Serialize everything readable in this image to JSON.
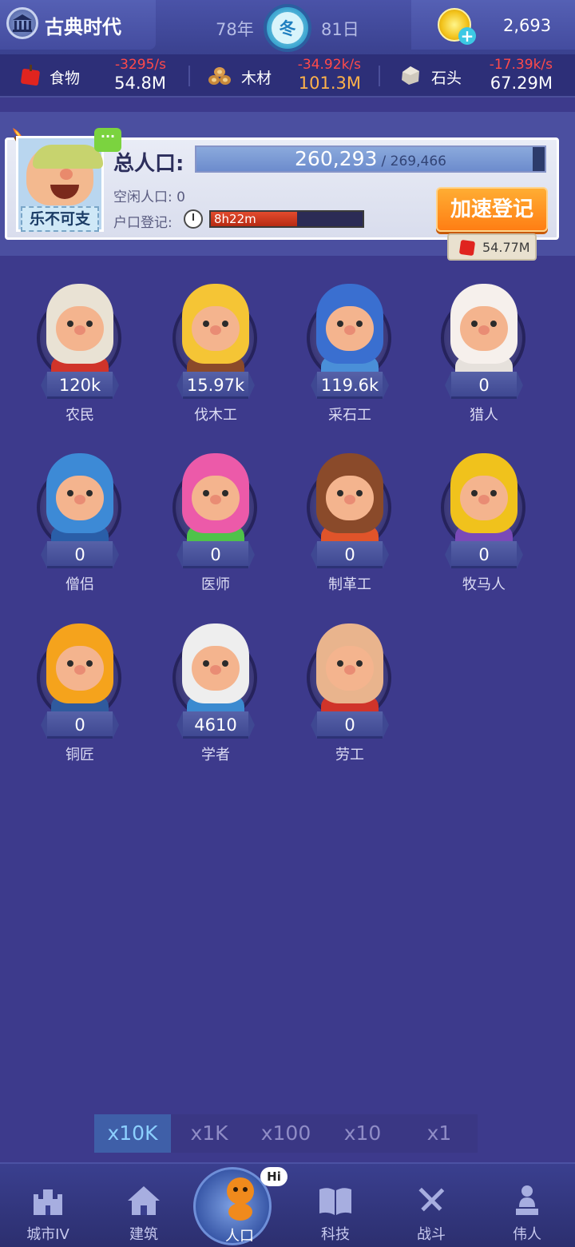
{
  "header": {
    "era_name": "古典时代",
    "year": "78年",
    "season": "冬",
    "day": "81日",
    "gold": "2,693"
  },
  "resources": [
    {
      "name": "食物",
      "rate": "-3295/s",
      "amount": "54.8M",
      "icon": "apple-icon"
    },
    {
      "name": "木材",
      "rate": "-34.92k/s",
      "amount": "101.3M",
      "icon": "logs-icon"
    },
    {
      "name": "石头",
      "rate": "-17.39k/s",
      "amount": "67.29M",
      "icon": "stone-icon"
    }
  ],
  "population": {
    "leader_label": "乐不可支",
    "chat_icon": "···",
    "title": "总人口:",
    "current": "260,293",
    "max": "/ 269,466",
    "fill_fraction": 0.966,
    "idle": "空闲人口: 0",
    "registration_label": "户口登记:",
    "registration_time": "8h22m",
    "registration_fraction": 0.57,
    "speedup_label": "加速登记",
    "speedup_cost": "54.77M"
  },
  "occupations": [
    {
      "label": "农民",
      "count": "120k"
    },
    {
      "label": "伐木工",
      "count": "15.97k"
    },
    {
      "label": "采石工",
      "count": "119.6k"
    },
    {
      "label": "猎人",
      "count": "0"
    },
    {
      "label": "僧侣",
      "count": "0"
    },
    {
      "label": "医师",
      "count": "0"
    },
    {
      "label": "制革工",
      "count": "0"
    },
    {
      "label": "牧马人",
      "count": "0"
    },
    {
      "label": "铜匠",
      "count": "0"
    },
    {
      "label": "学者",
      "count": "4610"
    },
    {
      "label": "劳工",
      "count": "0"
    }
  ],
  "multipliers": [
    "x10K",
    "x1K",
    "x100",
    "x10",
    "x1"
  ],
  "multiplier_selected": "x10K",
  "nav": [
    {
      "label": "城市IV",
      "icon": "castle-icon"
    },
    {
      "label": "建筑",
      "icon": "house-icon"
    },
    {
      "label": "人口",
      "icon": "person-icon"
    },
    {
      "label": "科技",
      "icon": "book-icon"
    },
    {
      "label": "战斗",
      "icon": "swords-icon"
    },
    {
      "label": "伟人",
      "icon": "statue-icon"
    }
  ],
  "nav_active": "人口",
  "hi_badge": "Hi"
}
